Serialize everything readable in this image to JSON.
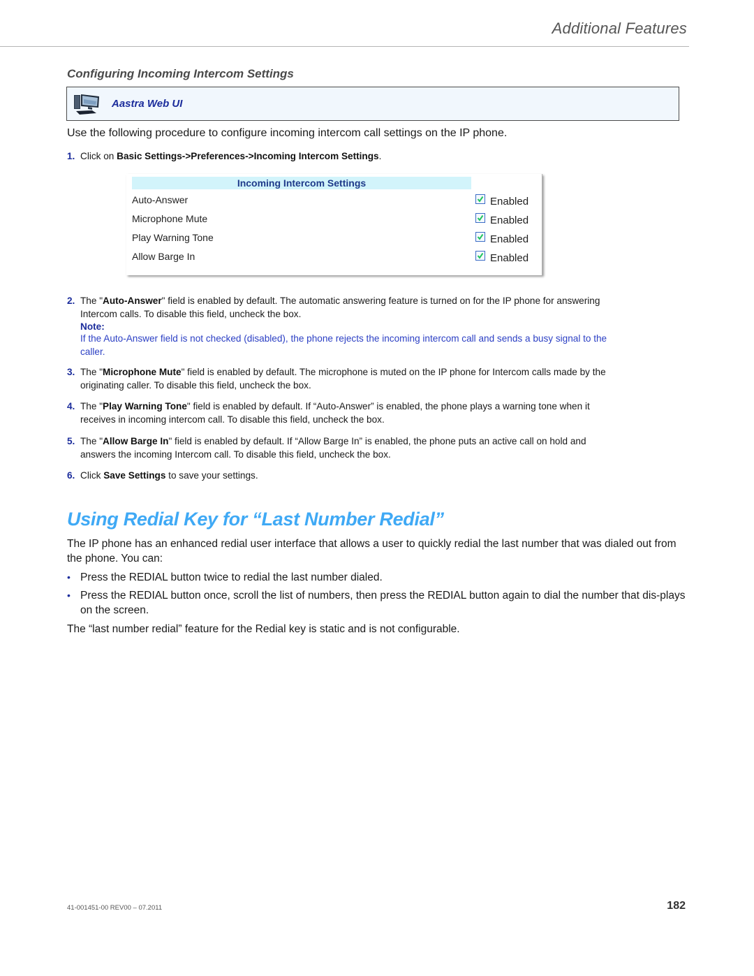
{
  "header": {
    "running_title": "Additional Features"
  },
  "section": {
    "title": "Configuring Incoming Intercom Settings",
    "webui_label": "Aastra Web UI",
    "intro": "Use the following procedure to configure incoming intercom call settings on the IP phone.",
    "steps": [
      {
        "num": "1.",
        "pre": "Click on ",
        "bold": "Basic Settings->Preferences->Incoming Intercom Settings",
        "post": "."
      },
      {
        "num": "2.",
        "pre": "The \"",
        "bold": "Auto-Answer",
        "post": "\" field is enabled by default. The automatic answering feature is turned on for the IP phone for answering Intercom calls. To disable this field, uncheck the box.",
        "note_label": "Note:",
        "note_text": "If the Auto-Answer field is not checked (disabled), the phone rejects the incoming intercom call and sends a busy signal to the caller."
      },
      {
        "num": "3.",
        "pre": "The \"",
        "bold": "Microphone Mute",
        "post": "\" field is enabled by default. The microphone is muted on the IP phone for Intercom calls made by the originating caller. To disable this field, uncheck the box."
      },
      {
        "num": "4.",
        "pre": "The \"",
        "bold": "Play Warning Tone",
        "post": "\" field is enabled by default. If “Auto-Answer” is enabled, the phone plays a warning tone when it receives in incoming intercom call. To disable this field, uncheck the box."
      },
      {
        "num": "5.",
        "pre": "The \"",
        "bold": "Allow Barge In",
        "post": "\" field is enabled by default. If “Allow Barge In” is enabled, the phone puts an active call on hold and answers the incoming Intercom call. To disable this field, uncheck the box."
      },
      {
        "num": "6.",
        "pre": "Click ",
        "bold": "Save Settings",
        "post": " to save your settings."
      }
    ]
  },
  "ui_panel": {
    "header": "Incoming Intercom Settings",
    "rows": [
      {
        "label": "Auto-Answer",
        "checked": true,
        "value_label": "Enabled"
      },
      {
        "label": "Microphone Mute",
        "checked": true,
        "value_label": "Enabled"
      },
      {
        "label": "Play Warning Tone",
        "checked": true,
        "value_label": "Enabled"
      },
      {
        "label": "Allow Barge In",
        "checked": true,
        "value_label": "Enabled"
      }
    ]
  },
  "redial": {
    "title": "Using Redial Key for “Last Number Redial”",
    "intro": "The IP phone has an enhanced redial user interface that allows a user to quickly redial the last number that was dialed out from the phone. You can:",
    "bullets": [
      "Press the REDIAL button twice to redial the last number dialed.",
      "Press the REDIAL button once, scroll the list of numbers, then press the REDIAL button again to dial the number that dis-plays on the screen."
    ],
    "closing": "The “last number redial” feature for the Redial key is static and is not configurable."
  },
  "footer": {
    "doc_id": "41-001451-00 REV00 – 07.2011",
    "page_number": "182"
  },
  "colors": {
    "accent_blue": "#1c2d9c",
    "heading_blue": "#3fa9f5",
    "note_blue": "#2b3fc4",
    "panel_header_bg": "#d2f4fb",
    "checkbox_check": "#22c55e"
  }
}
